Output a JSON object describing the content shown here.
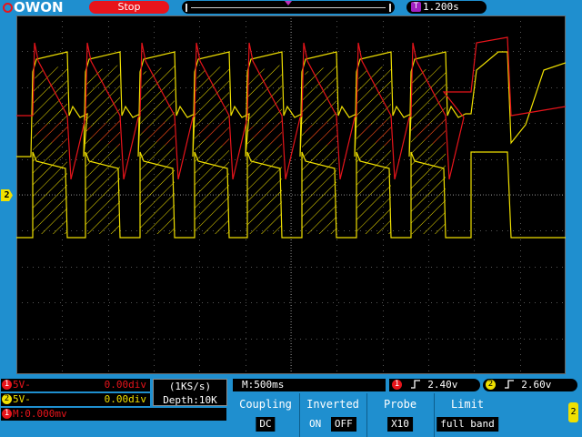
{
  "header": {
    "logo": "OWON",
    "status": "Stop",
    "trigger_time": "1.200s",
    "trigger_time_icon": "T"
  },
  "screen": {
    "ch2_marker": "2"
  },
  "channels": {
    "ch1": {
      "num": "1",
      "scale": "5V-",
      "offset": "0.00div",
      "color": "#e8141b"
    },
    "ch2": {
      "num": "2",
      "scale": "5V-",
      "offset": "0.00div",
      "color": "#f0e000"
    },
    "math": {
      "num": "1",
      "label": "M:",
      "value": "0.000mv"
    }
  },
  "acquisition": {
    "sample_rate": "(1KS/s)",
    "depth": "Depth:10K",
    "timebase": "M:500ms"
  },
  "triggers": {
    "ch1": {
      "num": "1",
      "level": "2.40v"
    },
    "ch2": {
      "num": "2",
      "level": "2.60v"
    }
  },
  "menu": {
    "coupling": {
      "label": "Coupling",
      "value": "DC"
    },
    "inverted": {
      "label": "Inverted",
      "on": "ON",
      "off": "OFF"
    },
    "probe": {
      "label": "Probe",
      "value": "X10"
    },
    "limit": {
      "label": "Limit",
      "value": "full band"
    },
    "side_marker": "2"
  },
  "colors": {
    "screen_bg": "#1f8fcf",
    "ch1": "#e8141b",
    "ch2": "#f0e000"
  }
}
